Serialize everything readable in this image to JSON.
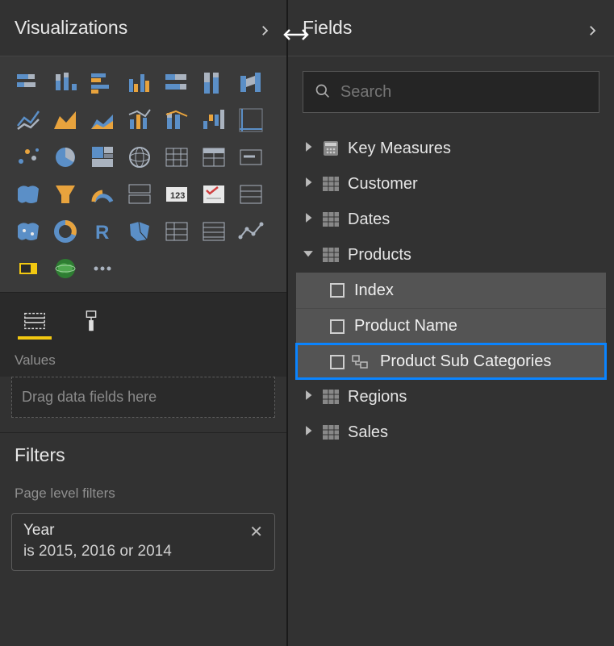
{
  "visualizations": {
    "title": "Visualizations",
    "viz_icons": [
      "stacked-bar",
      "stacked-column",
      "clustered-bar",
      "clustered-column",
      "100-stacked-bar",
      "100-stacked-column",
      "ribbon",
      "line",
      "area",
      "stacked-area",
      "line-clustered-column",
      "line-stacked-column",
      "waterfall",
      "scatter",
      "scatter-chart",
      "pie",
      "treemap",
      "globe",
      "table",
      "matrix",
      "card",
      "filled-map",
      "funnel",
      "gauge",
      "multi-row-card",
      "kpi",
      "slicer",
      "table-alt",
      "filled-map-2",
      "donut",
      "r-visual",
      "shape-map",
      "matrix-2",
      "table-2",
      "line-dots",
      "python-visual",
      "arcgis",
      "more-ellipsis"
    ],
    "tabs": {
      "fields": "Fields",
      "format": "Format"
    },
    "values_label": "Values",
    "values_placeholder": "Drag data fields here"
  },
  "filters": {
    "title": "Filters",
    "page_level_label": "Page level filters",
    "chips": [
      {
        "name": "Year",
        "desc": "is 2015, 2016 or 2014"
      }
    ]
  },
  "fields": {
    "title": "Fields",
    "search_placeholder": "Search",
    "tables": [
      {
        "name": "Key Measures",
        "icon": "calculator",
        "expanded": false
      },
      {
        "name": "Customer",
        "icon": "table",
        "expanded": false
      },
      {
        "name": "Dates",
        "icon": "table",
        "expanded": false
      },
      {
        "name": "Products",
        "icon": "table",
        "expanded": true,
        "fields": [
          {
            "name": "Index",
            "type": "column",
            "selected": false
          },
          {
            "name": "Product Name",
            "type": "column",
            "selected": false
          },
          {
            "name": "Product Sub Categories",
            "type": "hierarchy",
            "selected": true
          }
        ]
      },
      {
        "name": "Regions",
        "icon": "table",
        "expanded": false
      },
      {
        "name": "Sales",
        "icon": "table",
        "expanded": false
      }
    ]
  }
}
